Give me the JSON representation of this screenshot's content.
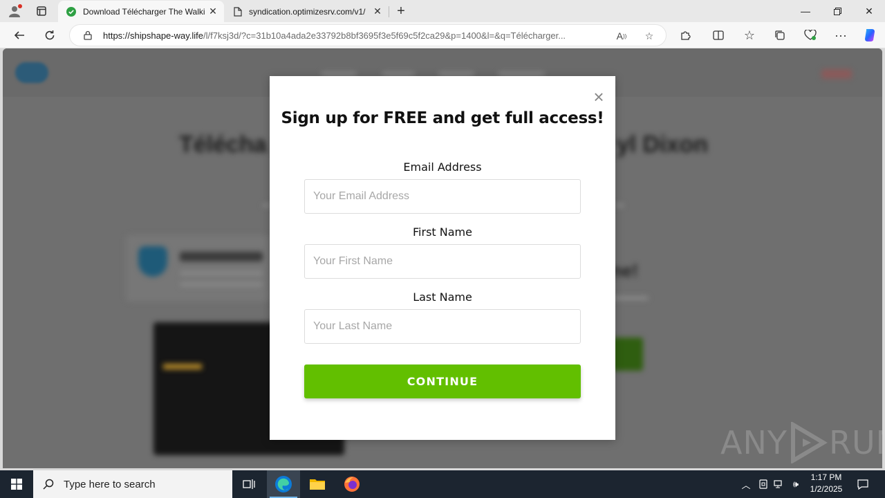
{
  "browser": {
    "tabs": [
      {
        "title": "Download Télécharger The Walki",
        "active": true,
        "icon": "check-circle-icon"
      },
      {
        "title": "syndication.optimizesrv.com/v1/",
        "active": false,
        "icon": "page-icon"
      }
    ],
    "address": {
      "host": "https://shipshape-way.life",
      "path": "/l/f7ksj3d/?c=31b10a4ada2e33792b8bf3695f3e5f69c5f2ca29&p=1400&l=&q=Télécharger..."
    }
  },
  "modal": {
    "title": "Sign up for FREE and get full access!",
    "email_label": "Email Address",
    "email_placeholder": "Your Email Address",
    "first_label": "First Name",
    "first_placeholder": "Your First Name",
    "last_label": "Last Name",
    "last_placeholder": "Your Last Name",
    "button": "CONTINUE",
    "button_color": "#62bf00"
  },
  "background": {
    "title_left": "Télécha",
    "title_right": "yl Dixon",
    "side_text": "ne!"
  },
  "watermark": {
    "left": "ANY",
    "right": "RUN"
  },
  "taskbar": {
    "search_placeholder": "Type here to search",
    "time": "1:17 PM",
    "date": "1/2/2025"
  }
}
